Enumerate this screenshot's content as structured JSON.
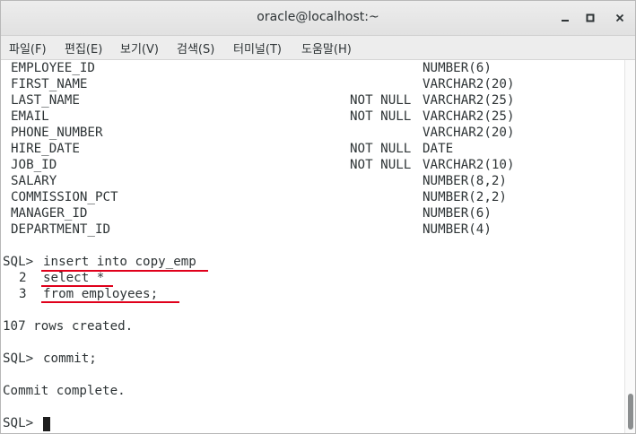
{
  "window": {
    "title": "oracle@localhost:~",
    "buttons": {
      "minimize_icon": "minimize-icon",
      "maximize_icon": "maximize-icon",
      "close_icon": "close-icon"
    }
  },
  "menu": [
    "파일(F)",
    "편집(E)",
    "보기(V)",
    "검색(S)",
    "터미널(T)",
    "도움말(H)"
  ],
  "describe_rows": [
    {
      "name": "EMPLOYEE_ID",
      "null": "",
      "type": "NUMBER(6)"
    },
    {
      "name": "FIRST_NAME",
      "null": "",
      "type": "VARCHAR2(20)"
    },
    {
      "name": "LAST_NAME",
      "null": "NOT NULL",
      "type": "VARCHAR2(25)"
    },
    {
      "name": "EMAIL",
      "null": "NOT NULL",
      "type": "VARCHAR2(25)"
    },
    {
      "name": "PHONE_NUMBER",
      "null": "",
      "type": "VARCHAR2(20)"
    },
    {
      "name": "HIRE_DATE",
      "null": "NOT NULL",
      "type": "DATE"
    },
    {
      "name": "JOB_ID",
      "null": "NOT NULL",
      "type": "VARCHAR2(10)"
    },
    {
      "name": "SALARY",
      "null": "",
      "type": "NUMBER(8,2)"
    },
    {
      "name": "COMMISSION_PCT",
      "null": "",
      "type": "NUMBER(2,2)"
    },
    {
      "name": "MANAGER_ID",
      "null": "",
      "type": "NUMBER(6)"
    },
    {
      "name": "DEPARTMENT_ID",
      "null": "",
      "type": "NUMBER(4)"
    }
  ],
  "session": {
    "prompt": "SQL>",
    "insert_cmd": "insert into copy_emp",
    "line2_num": "2",
    "line2_cmd": "select *",
    "line3_num": "3",
    "line3_cmd": "from employees;",
    "rows_msg": "107 rows created.",
    "commit_cmd": "commit;",
    "commit_msg": "Commit complete.",
    "last_prompt": "SQL>"
  },
  "colors": {
    "text": "#2e3436",
    "annotation_underline": "#e0001b",
    "cursor": "#1e1e1e"
  }
}
